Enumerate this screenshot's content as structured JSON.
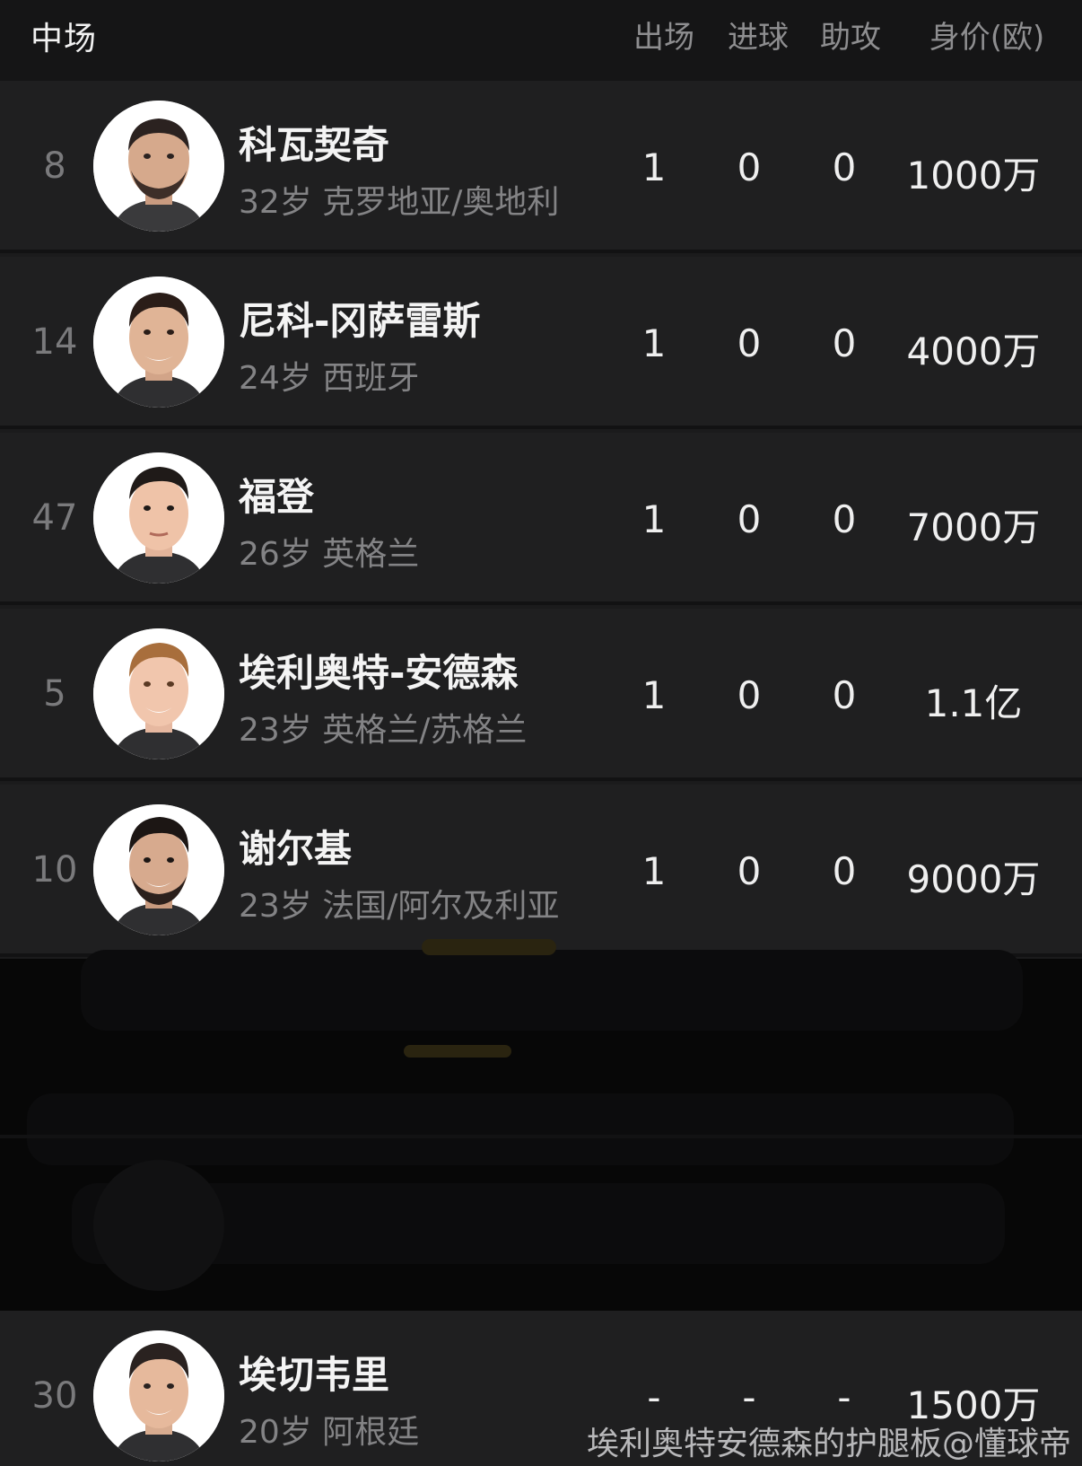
{
  "header": {
    "section_title": "中场",
    "col_apps": "出场",
    "col_goals": "进球",
    "col_assists": "助攻",
    "col_value": "身价(欧)"
  },
  "players": [
    {
      "number": "8",
      "name": "科瓦契奇",
      "info": "32岁 克罗地亚/奥地利",
      "apps": "1",
      "goals": "0",
      "assists": "0",
      "value": "1000万"
    },
    {
      "number": "14",
      "name": "尼科-冈萨雷斯",
      "info": "24岁 西班牙",
      "apps": "1",
      "goals": "0",
      "assists": "0",
      "value": "4000万"
    },
    {
      "number": "47",
      "name": "福登",
      "info": "26岁 英格兰",
      "apps": "1",
      "goals": "0",
      "assists": "0",
      "value": "7000万"
    },
    {
      "number": "5",
      "name": "埃利奥特-安德森",
      "info": "23岁 英格兰/苏格兰",
      "apps": "1",
      "goals": "0",
      "assists": "0",
      "value": "1.1亿"
    },
    {
      "number": "10",
      "name": "谢尔基",
      "info": "23岁 法国/阿尔及利亚",
      "apps": "1",
      "goals": "0",
      "assists": "0",
      "value": "9000万"
    },
    {
      "number": "30",
      "name": "埃切韦里",
      "info": "20岁 阿根廷",
      "apps": "-",
      "goals": "-",
      "assists": "-",
      "value": "1500万"
    }
  ],
  "watermark": "埃利奥特安德森的护腿板@懂球帝",
  "colors": {
    "background": "#1b1b1c",
    "header_bg": "#151516",
    "row_bg": "#1f1f20",
    "muted_text": "#838385"
  }
}
